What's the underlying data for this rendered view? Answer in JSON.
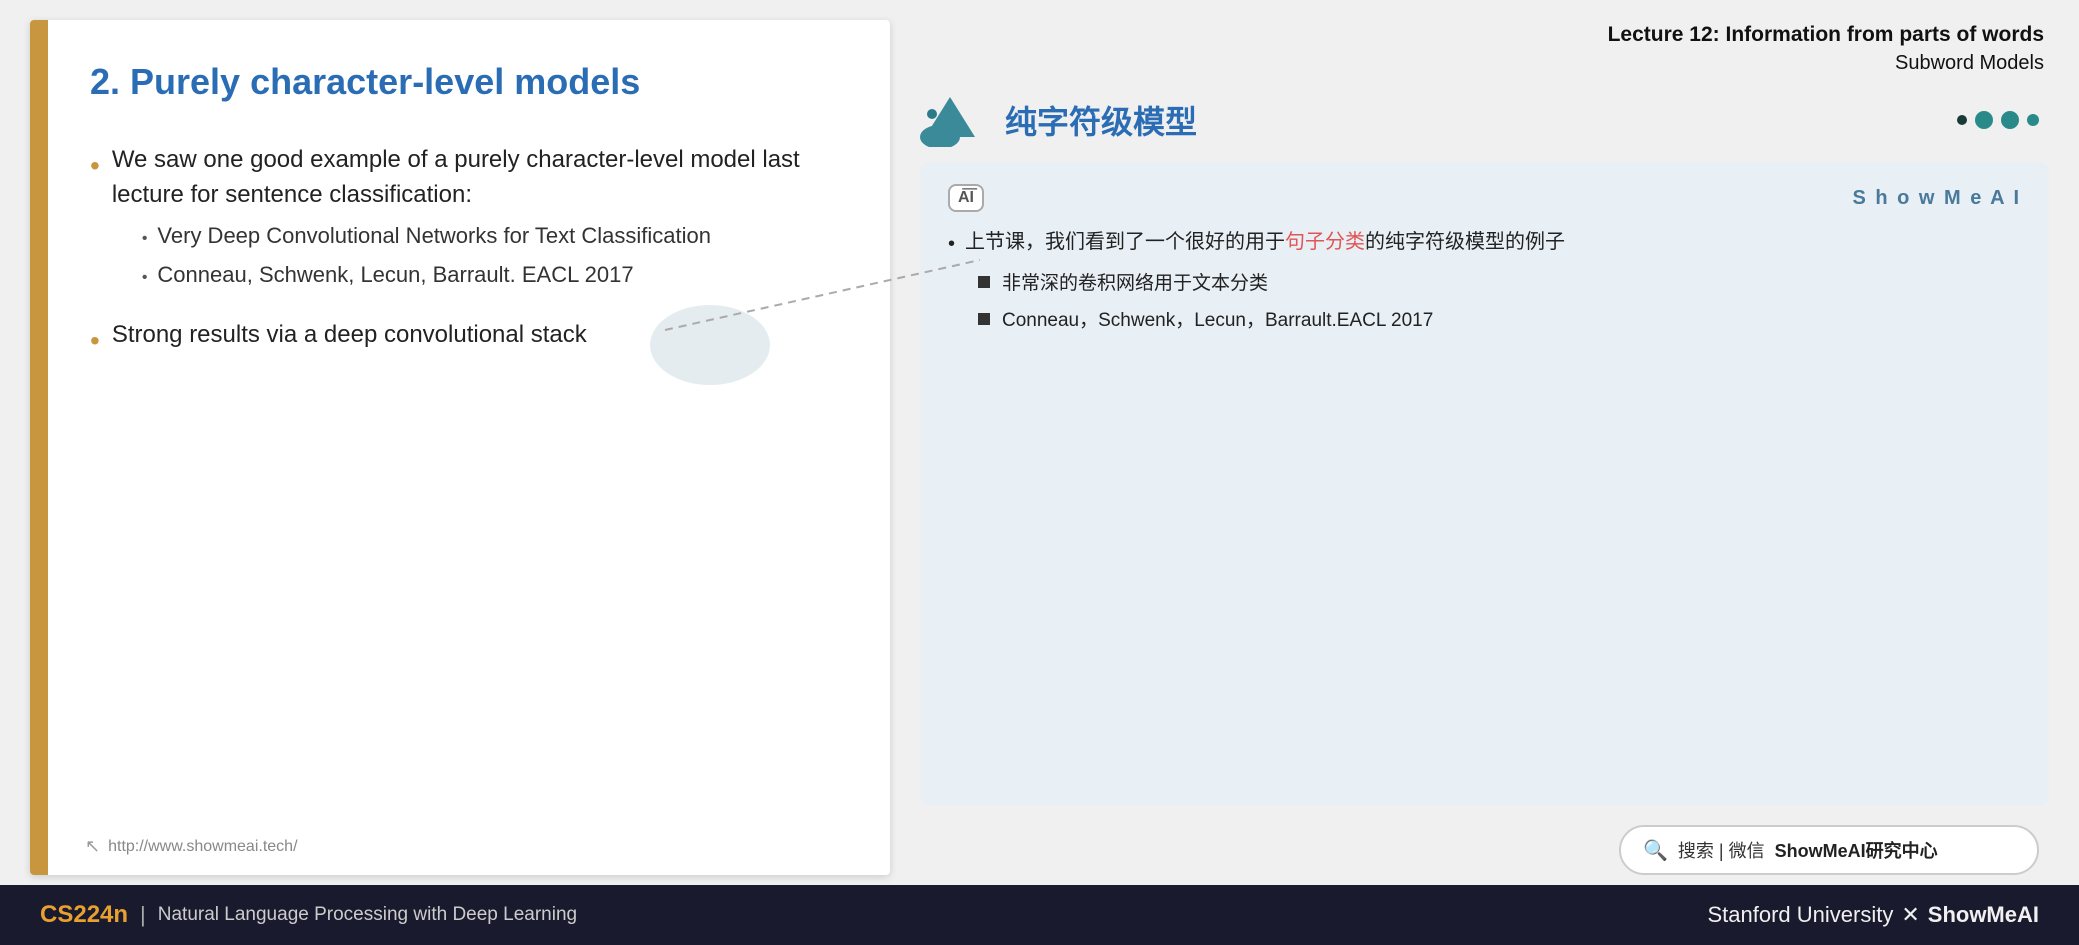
{
  "slide": {
    "title": "2. Purely character-level models",
    "bullets": [
      {
        "text": "We saw one good example of a purely character-level model last lecture for sentence classification:",
        "sub_bullets": [
          "Very Deep Convolutional Networks for Text Classification",
          "Conneau, Schwenk, Lecun, Barrault. EACL 2017"
        ]
      },
      {
        "text": "Strong results via a deep convolutional stack",
        "sub_bullets": []
      }
    ],
    "url": "http://www.showmeai.tech/"
  },
  "lecture_header": {
    "line1": "Lecture 12: Information from parts of words",
    "line2": "Subword Models"
  },
  "right_section": {
    "title": "纯字符级模型",
    "ai_badge": "AI",
    "showmeai_label": "S h o w M e A I",
    "card_bullet": "上节课，我们看到了一个很好的用于句子分类的纯字符级模型的例子",
    "highlight_text": "句子分类",
    "sub_bullets": [
      "非常深的卷积网络用于文本分类",
      "Conneau，Schwenk，Lecun，Barrault.EACL 2017"
    ]
  },
  "search_bar": {
    "icon": "🔍",
    "text": "搜索 | 微信",
    "brand": "ShowMeAI研究中心"
  },
  "footer": {
    "course": "CS224n",
    "divider": "|",
    "subtitle": "Natural Language Processing with Deep Learning",
    "university": "Stanford University",
    "x": "✕",
    "brand": "ShowMeAI"
  }
}
